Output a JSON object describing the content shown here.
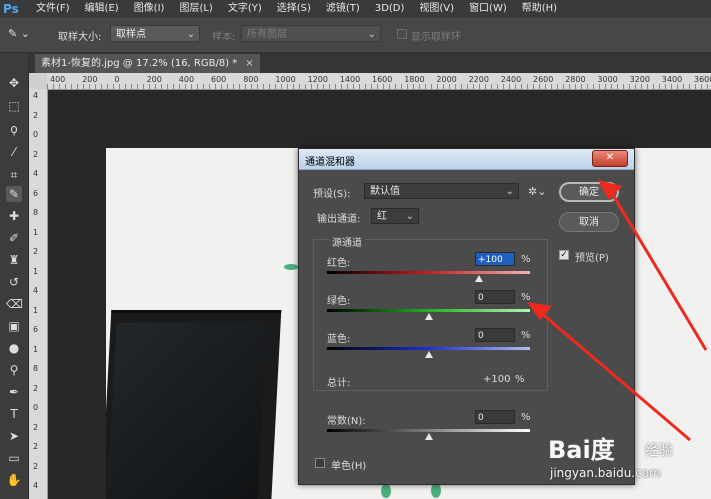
{
  "app": {
    "logo": "Ps"
  },
  "menu": [
    "文件(F)",
    "编辑(E)",
    "图像(I)",
    "图层(L)",
    "文字(Y)",
    "选择(S)",
    "滤镜(T)",
    "3D(D)",
    "视图(V)",
    "窗口(W)",
    "帮助(H)"
  ],
  "options": {
    "sample_size_label": "取样大小:",
    "sample_size_value": "取样点",
    "sample_label": "样本:",
    "sample_value": "所有图层",
    "show_ring_label": "显示取样环"
  },
  "document_tab": {
    "title": "素材1-恢复的.jpg @ 17.2% (16, RGB/8) *",
    "close": "×"
  },
  "ruler": {
    "h_ticks": [
      "400",
      "200",
      "0",
      "200",
      "400",
      "600",
      "800",
      "1000",
      "1200",
      "1400",
      "1600",
      "1800",
      "2000",
      "2200",
      "2400",
      "2600",
      "2800",
      "3000",
      "3200",
      "3400",
      "3600"
    ],
    "v_ticks": [
      "4",
      "2",
      "0",
      "2",
      "4",
      "6",
      "8",
      "1",
      "2",
      "1",
      "4",
      "1",
      "6",
      "1",
      "8",
      "2",
      "0",
      "2",
      "2",
      "2",
      "4"
    ]
  },
  "dialog": {
    "title": "通道混和器",
    "close_icon": "✕",
    "preset_label": "预设(S):",
    "preset_value": "默认值",
    "output_channel_label": "输出通道:",
    "output_channel_value": "红",
    "source_group_label": "源通道",
    "channels": [
      {
        "label": "红色:",
        "value": "+100",
        "unit": "%",
        "percent": 100,
        "color_from": "#000000",
        "color_mid": "#c81e1e",
        "color_to": "#f0b4b4"
      },
      {
        "label": "绿色:",
        "value": "0",
        "unit": "%",
        "percent": 0,
        "color_from": "#000000",
        "color_mid": "#1fb41f",
        "color_to": "#b4f0b4"
      },
      {
        "label": "蓝色:",
        "value": "0",
        "unit": "%",
        "percent": 0,
        "color_from": "#000000",
        "color_mid": "#1e2ed2",
        "color_to": "#b4bcf0"
      }
    ],
    "total_label": "总计:",
    "total_value": "+100",
    "total_unit": "%",
    "constant_label": "常数(N):",
    "constant_value": "0",
    "constant_unit": "%",
    "monochrome_label": "单色(H)",
    "ok_label": "确定",
    "cancel_label": "取消",
    "preview_label": "预览(P)",
    "preview_checked": true
  },
  "watermark": {
    "brand": "Bai度",
    "cn": "经验",
    "url": "jingyan.baidu.com"
  },
  "colors": {
    "annotation_red": "#f0281e",
    "accent_blue": "#4ea8f0"
  }
}
